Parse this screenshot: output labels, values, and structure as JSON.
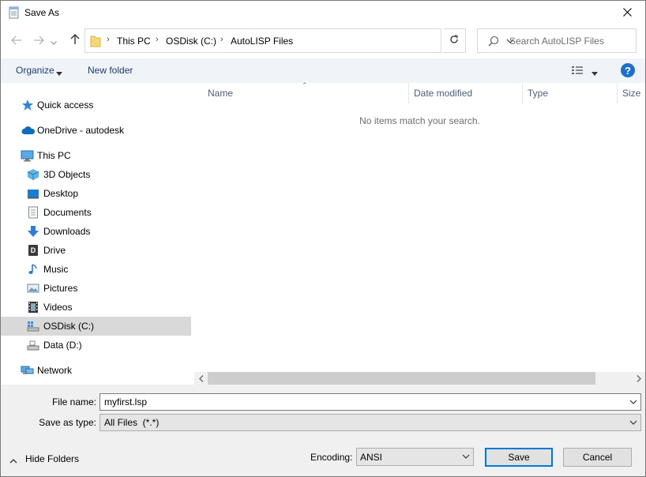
{
  "window": {
    "title": "Save As"
  },
  "address": {
    "crumbs": [
      "This PC",
      "OSDisk (C:)",
      "AutoLISP Files"
    ]
  },
  "search": {
    "placeholder": "Search AutoLISP Files"
  },
  "toolbar": {
    "organize_label": "Organize",
    "new_folder_label": "New folder"
  },
  "nav": {
    "items": [
      {
        "label": "Quick access",
        "icon": "quick-access-star-icon"
      },
      {
        "label": "OneDrive - autodesk",
        "icon": "onedrive-cloud-icon"
      },
      {
        "label": "This PC",
        "icon": "this-pc-icon"
      },
      {
        "label": "3D Objects",
        "icon": "3d-objects-icon"
      },
      {
        "label": "Desktop",
        "icon": "desktop-icon"
      },
      {
        "label": "Documents",
        "icon": "documents-icon"
      },
      {
        "label": "Downloads",
        "icon": "downloads-icon"
      },
      {
        "label": "Drive",
        "icon": "drive-icon"
      },
      {
        "label": "Music",
        "icon": "music-icon"
      },
      {
        "label": "Pictures",
        "icon": "pictures-icon"
      },
      {
        "label": "Videos",
        "icon": "videos-icon"
      },
      {
        "label": "OSDisk (C:)",
        "icon": "osdisk-icon",
        "selected": true
      },
      {
        "label": "Data (D:)",
        "icon": "data-drive-icon"
      },
      {
        "label": "Network",
        "icon": "network-icon"
      }
    ]
  },
  "file_list": {
    "columns": [
      "Name",
      "Date modified",
      "Type",
      "Size"
    ],
    "empty_message": "No items match your search."
  },
  "form": {
    "file_name_label": "File name:",
    "file_name_value": "myfirst.lsp",
    "save_as_type_label": "Save as type:",
    "save_as_type_value": "All Files  (*.*)",
    "hide_folders_label": "Hide Folders",
    "encoding_label": "Encoding:",
    "encoding_value": "ANSI",
    "save_label": "Save",
    "cancel_label": "Cancel"
  },
  "colors": {
    "accent": "#0078d7",
    "link": "#1a3e6e",
    "selected": "#d9d9d9"
  }
}
